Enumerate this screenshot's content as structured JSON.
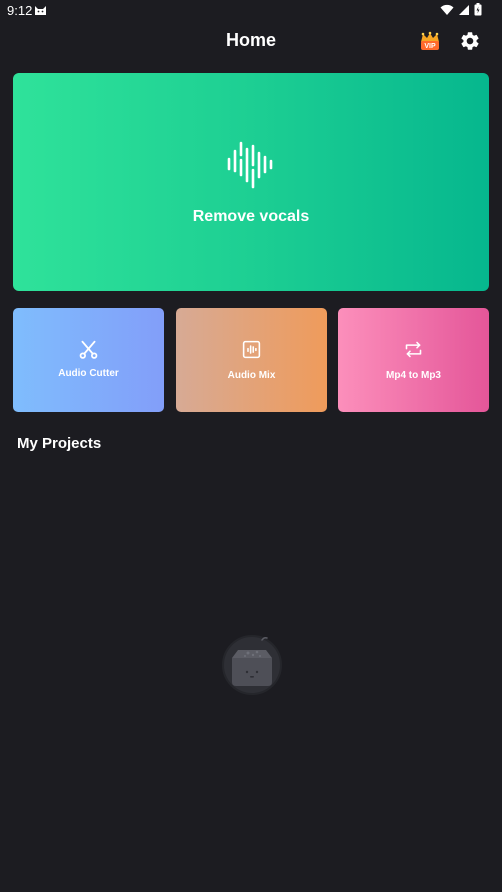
{
  "status_bar": {
    "time": "9:12"
  },
  "app_bar": {
    "title": "Home",
    "vip_badge": "VIP"
  },
  "hero": {
    "label": "Remove vocals"
  },
  "tools": [
    {
      "label": "Audio Cutter",
      "icon": "scissors-icon"
    },
    {
      "label": "Audio Mix",
      "icon": "waveform-box-icon"
    },
    {
      "label": "Mp4 to Mp3",
      "icon": "repeat-arrows-icon"
    }
  ],
  "projects": {
    "title": "My Projects"
  },
  "colors": {
    "background": "#1c1c21",
    "hero_start": "#2fe29a",
    "hero_end": "#06b78e",
    "cutter_start": "#7fbdfd",
    "cutter_end": "#829ef9",
    "mix_start": "#d7aa95",
    "mix_end": "#ef9b5b",
    "convert_start": "#fc8fbb",
    "convert_end": "#e45699"
  }
}
